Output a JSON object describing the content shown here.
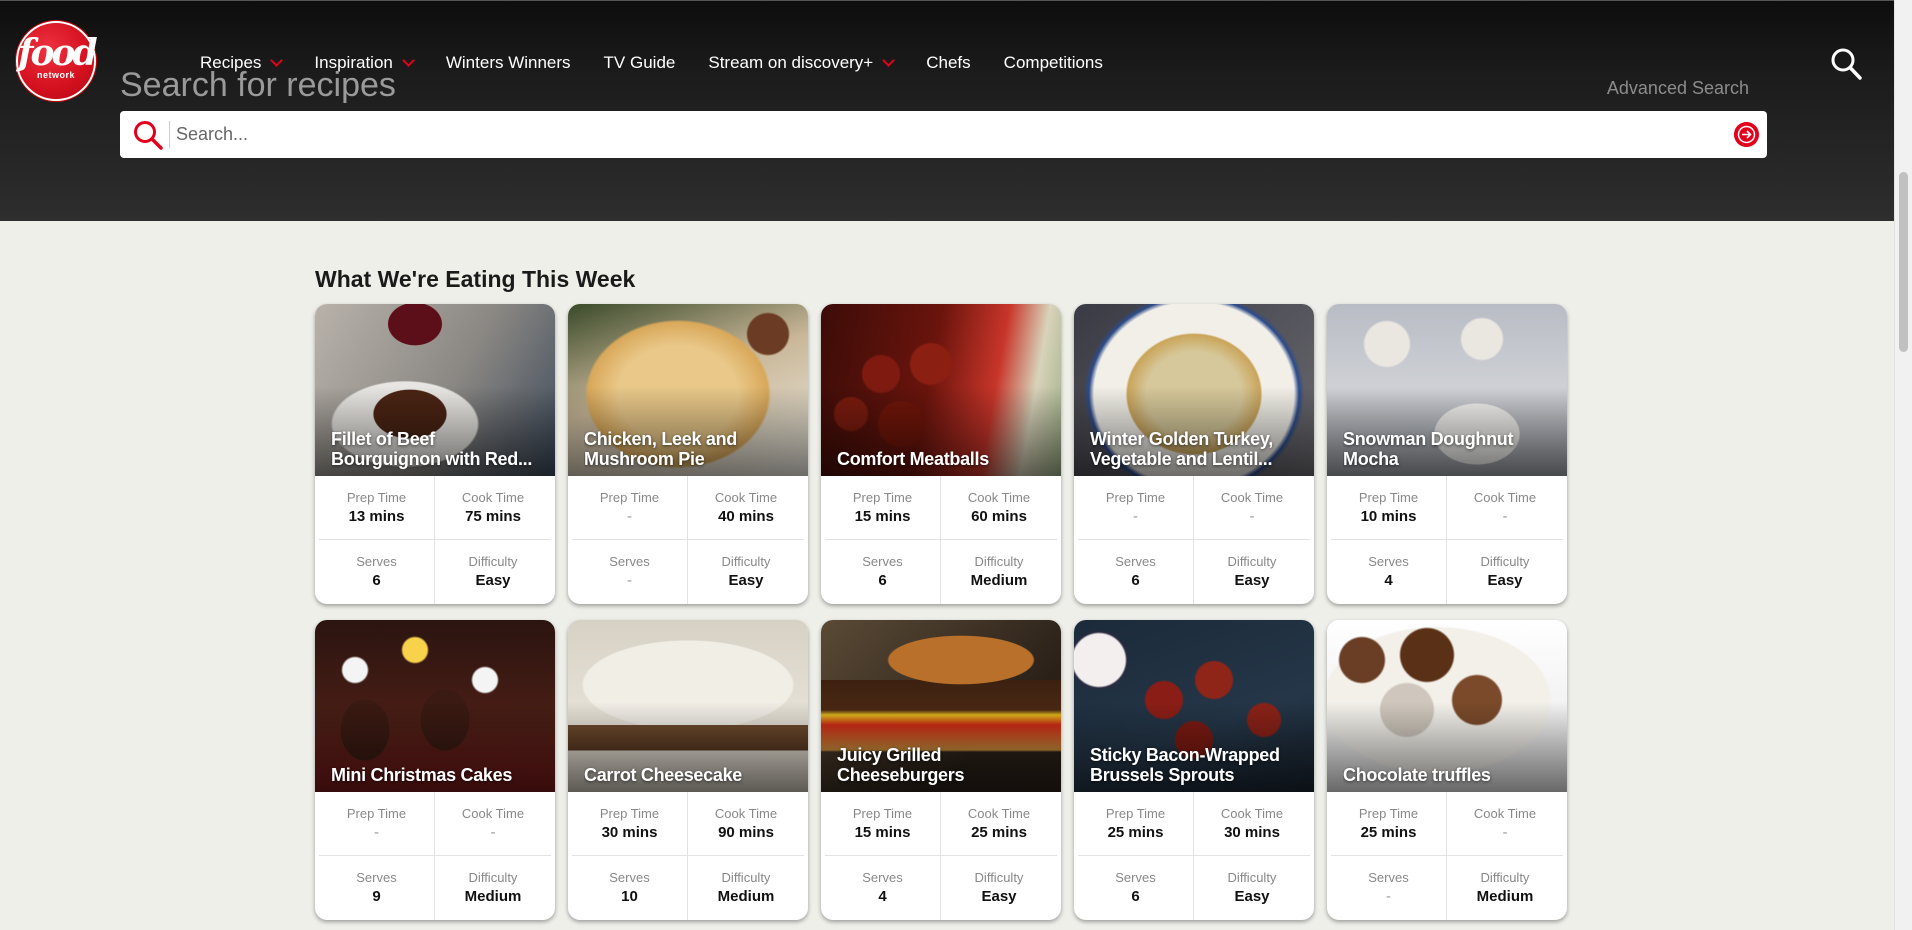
{
  "logo": {
    "line1": "food",
    "line2": "network"
  },
  "nav": [
    {
      "label": "Recipes",
      "dropdown": true
    },
    {
      "label": "Inspiration",
      "dropdown": true
    },
    {
      "label": "Winters Winners",
      "dropdown": false
    },
    {
      "label": "TV Guide",
      "dropdown": false
    },
    {
      "label": "Stream on discovery+",
      "dropdown": true
    },
    {
      "label": "Chefs",
      "dropdown": false
    },
    {
      "label": "Competitions",
      "dropdown": false
    }
  ],
  "search": {
    "title": "Search for recipes",
    "advanced": "Advanced Search",
    "placeholder": "Search...",
    "value": ""
  },
  "section": {
    "title": "What We're Eating This Week"
  },
  "labels": {
    "prep": "Prep Time",
    "cook": "Cook Time",
    "serves": "Serves",
    "difficulty": "Difficulty"
  },
  "colors": {
    "brand_red": "#e3001b",
    "header_bg": "#1b1b1b",
    "page_bg": "#efefea"
  },
  "recipes": [
    {
      "title": "Fillet of Beef Bourguignon with Red...",
      "prep": "13 mins",
      "cook": "75 mins",
      "serves": "6",
      "difficulty": "Easy",
      "image": "bg-beef"
    },
    {
      "title": "Chicken, Leek and Mushroom Pie",
      "prep": "-",
      "cook": "40 mins",
      "serves": "-",
      "difficulty": "Easy",
      "image": "bg-pie"
    },
    {
      "title": "Comfort Meatballs",
      "prep": "15 mins",
      "cook": "60 mins",
      "serves": "6",
      "difficulty": "Medium",
      "image": "bg-meatballs"
    },
    {
      "title": "Winter Golden Turkey, Vegetable and Lentil...",
      "prep": "-",
      "cook": "-",
      "serves": "6",
      "difficulty": "Easy",
      "image": "bg-turkey"
    },
    {
      "title": "Snowman Doughnut Mocha",
      "prep": "10 mins",
      "cook": "-",
      "serves": "4",
      "difficulty": "Easy",
      "image": "bg-snowman"
    },
    {
      "title": "Mini Christmas Cakes",
      "prep": "-",
      "cook": "-",
      "serves": "9",
      "difficulty": "Medium",
      "image": "bg-cakes"
    },
    {
      "title": "Carrot Cheesecake",
      "prep": "30 mins",
      "cook": "90 mins",
      "serves": "10",
      "difficulty": "Medium",
      "image": "bg-cheesecake"
    },
    {
      "title": "Juicy Grilled Cheeseburgers",
      "prep": "15 mins",
      "cook": "25 mins",
      "serves": "4",
      "difficulty": "Easy",
      "image": "bg-burger"
    },
    {
      "title": "Sticky Bacon-Wrapped Brussels Sprouts",
      "prep": "25 mins",
      "cook": "30 mins",
      "serves": "6",
      "difficulty": "Easy",
      "image": "bg-sprouts"
    },
    {
      "title": "Chocolate truffles",
      "prep": "25 mins",
      "cook": "-",
      "serves": "-",
      "difficulty": "Medium",
      "image": "bg-truffles"
    }
  ]
}
